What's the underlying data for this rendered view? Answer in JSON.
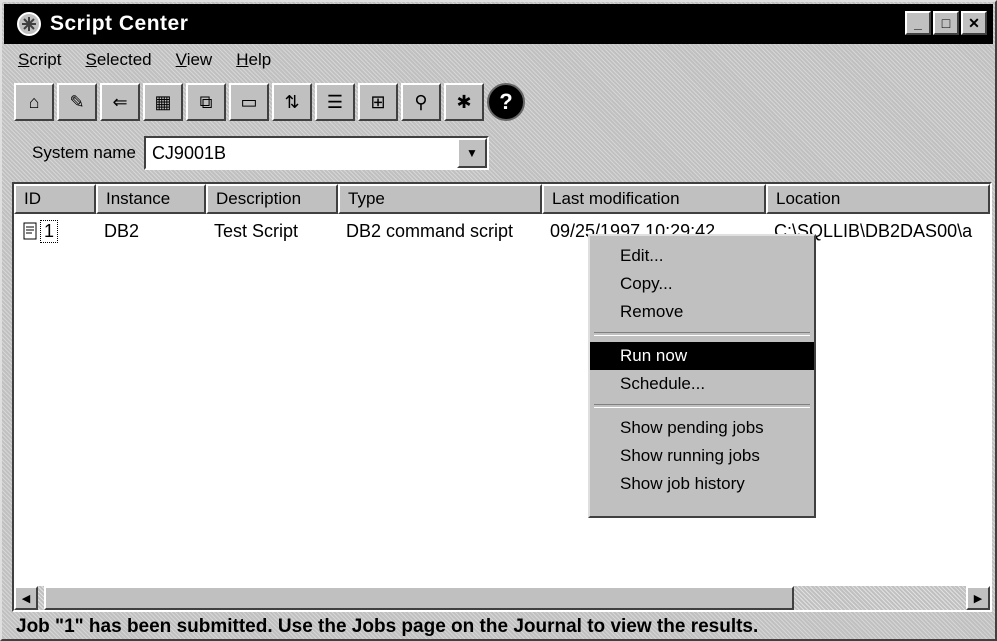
{
  "window": {
    "title": "Script Center",
    "buttons": [
      "_",
      "□",
      "✕"
    ]
  },
  "menubar": {
    "items": [
      "Script",
      "Selected",
      "View",
      "Help"
    ]
  },
  "toolbar": {
    "help_glyph": "?"
  },
  "system": {
    "label": "System name",
    "value": "CJ9001B"
  },
  "columns": [
    "ID",
    "Instance",
    "Description",
    "Type",
    "Last modification",
    "Location"
  ],
  "rows": [
    {
      "id": "1",
      "instance": "DB2",
      "description": "Test Script",
      "type": "DB2 command script",
      "modified": "09/25/1997  10:29:42",
      "location": "C:\\SQLLIB\\DB2DAS00\\a"
    }
  ],
  "context_menu": {
    "items": [
      "Edit...",
      "Copy...",
      "Remove",
      "Run now",
      "Schedule...",
      "Show pending jobs",
      "Show running jobs",
      "Show job history"
    ],
    "selected": "Run now"
  },
  "status": "Job \"1\" has been submitted.  Use the Jobs page on the Journal to view the results."
}
